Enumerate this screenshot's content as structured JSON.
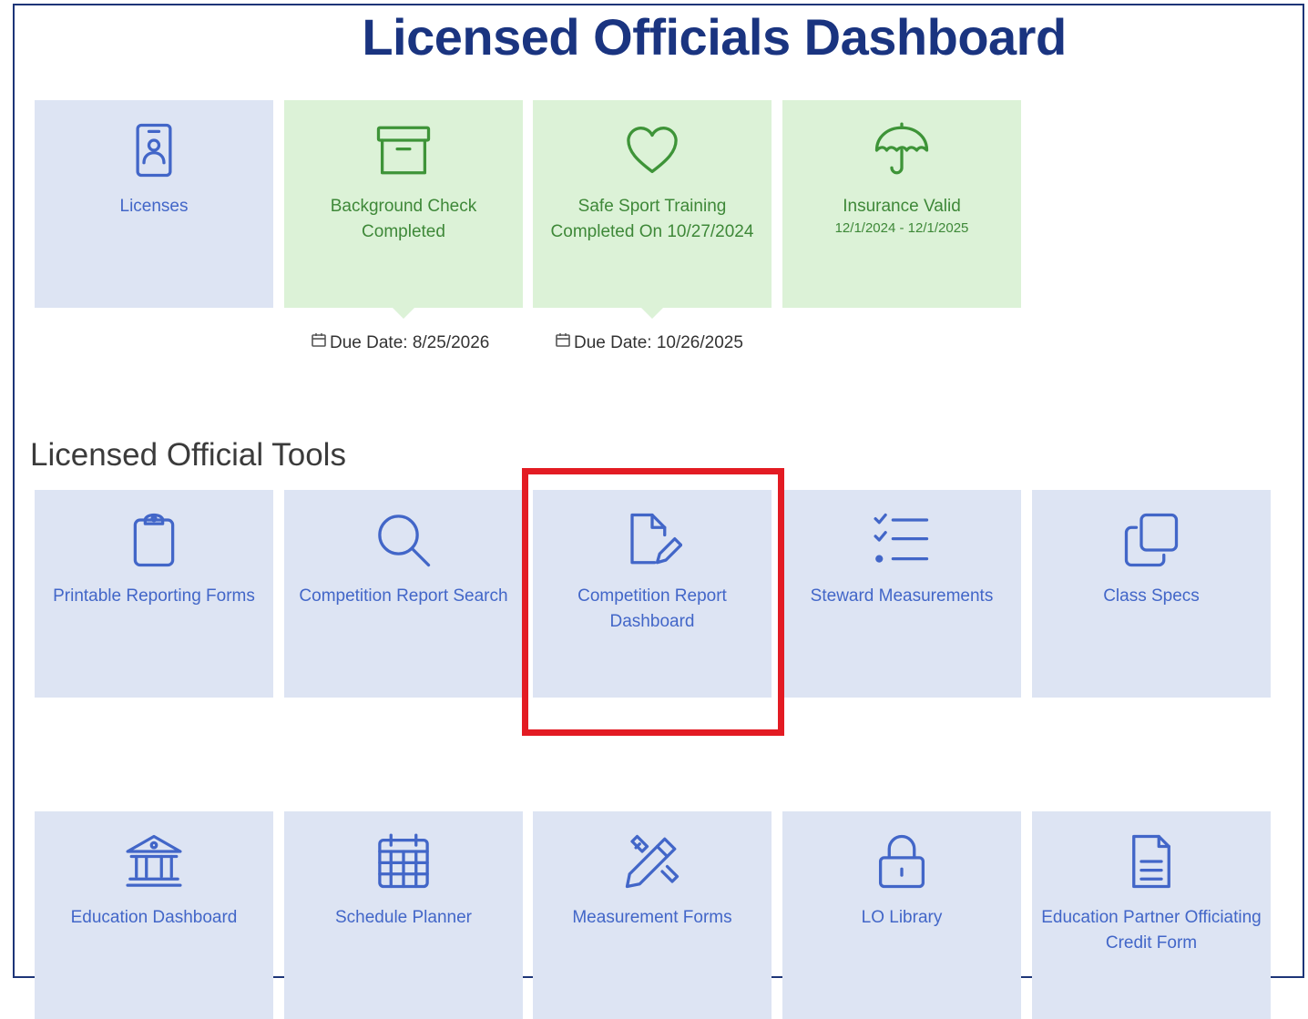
{
  "page": {
    "title": "Licensed Officials Dashboard"
  },
  "status_tiles": [
    {
      "label": "Licenses",
      "icon": "id-badge-icon",
      "color": "#4266c8"
    },
    {
      "label": "Background Check Completed",
      "icon": "archive-box-icon",
      "color": "#3e9438",
      "due_date": "Due Date: 8/25/2026"
    },
    {
      "label": "Safe Sport Training Completed On 10/27/2024",
      "icon": "heart-icon",
      "color": "#3e9438",
      "due_date": "Due Date: 10/26/2025"
    },
    {
      "label": "Insurance Valid",
      "sublabel": "12/1/2024 - 12/1/2025",
      "icon": "umbrella-icon",
      "color": "#3e9438"
    }
  ],
  "tools": {
    "title": "Licensed Official Tools",
    "items": [
      {
        "label": "Printable Reporting Forms",
        "icon": "clipboard-icon"
      },
      {
        "label": "Competition Report Search",
        "icon": "search-icon"
      },
      {
        "label": "Competition Report Dashboard",
        "icon": "document-edit-icon",
        "highlighted": true
      },
      {
        "label": "Steward Measurements",
        "icon": "checklist-icon"
      },
      {
        "label": "Class Specs",
        "icon": "copy-icon"
      },
      {
        "label": "Education Dashboard",
        "icon": "institution-icon"
      },
      {
        "label": "Schedule Planner",
        "icon": "calendar-icon"
      },
      {
        "label": "Measurement Forms",
        "icon": "pencil-ruler-icon"
      },
      {
        "label": "LO Library",
        "icon": "lock-icon"
      },
      {
        "label": "Education Partner Officiating Credit Form",
        "icon": "document-text-icon"
      }
    ]
  },
  "colors": {
    "title": "#1a3480",
    "tile_blue": "#dde4f3",
    "tile_green": "#dcf2d7",
    "highlight": "#e31b23"
  }
}
